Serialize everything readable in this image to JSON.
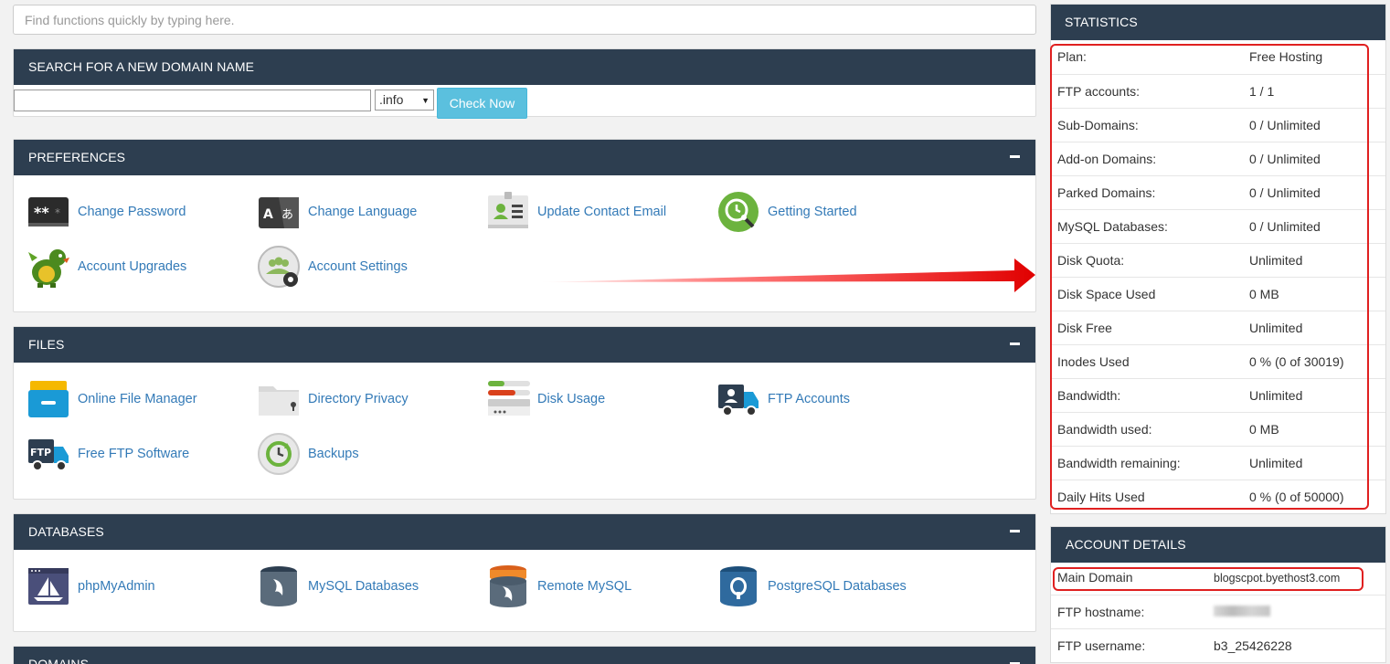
{
  "quick_search": {
    "placeholder": "Find functions quickly by typing here."
  },
  "domain_search": {
    "title": "SEARCH FOR A NEW DOMAIN NAME",
    "input_value": "",
    "tld_selected": ".info",
    "check_label": "Check Now"
  },
  "preferences": {
    "title": "PREFERENCES",
    "items": [
      {
        "label": "Change Password",
        "icon": "password-icon"
      },
      {
        "label": "Change Language",
        "icon": "language-icon"
      },
      {
        "label": "Update Contact Email",
        "icon": "contact-card-icon"
      },
      {
        "label": "Getting Started",
        "icon": "getting-started-icon"
      },
      {
        "label": "Account Upgrades",
        "icon": "dragon-icon"
      },
      {
        "label": "Account Settings",
        "icon": "account-settings-icon"
      }
    ]
  },
  "files": {
    "title": "FILES",
    "items": [
      {
        "label": "Online File Manager",
        "icon": "file-manager-icon"
      },
      {
        "label": "Directory Privacy",
        "icon": "folder-lock-icon"
      },
      {
        "label": "Disk Usage",
        "icon": "disk-usage-icon"
      },
      {
        "label": "FTP Accounts",
        "icon": "ftp-truck-icon"
      },
      {
        "label": "Free FTP Software",
        "icon": "ftp-software-icon"
      },
      {
        "label": "Backups",
        "icon": "backup-icon"
      }
    ]
  },
  "databases": {
    "title": "DATABASES",
    "items": [
      {
        "label": "phpMyAdmin",
        "icon": "phpmyadmin-icon"
      },
      {
        "label": "MySQL Databases",
        "icon": "mysql-icon"
      },
      {
        "label": "Remote MySQL",
        "icon": "remote-mysql-icon"
      },
      {
        "label": "PostgreSQL Databases",
        "icon": "postgresql-icon"
      }
    ]
  },
  "domains": {
    "title": "DOMAINS"
  },
  "statistics": {
    "title": "STATISTICS",
    "rows": [
      {
        "k": "Plan:",
        "v": "Free Hosting"
      },
      {
        "k": "FTP accounts:",
        "v": "1 / 1"
      },
      {
        "k": "Sub-Domains:",
        "v": "0 / Unlimited"
      },
      {
        "k": "Add-on Domains:",
        "v": "0 / Unlimited"
      },
      {
        "k": "Parked Domains:",
        "v": "0 / Unlimited"
      },
      {
        "k": "MySQL Databases:",
        "v": "0 / Unlimited"
      },
      {
        "k": "Disk Quota:",
        "v": "Unlimited"
      },
      {
        "k": "Disk Space Used",
        "v": "0 MB"
      },
      {
        "k": "Disk Free",
        "v": "Unlimited"
      },
      {
        "k": "Inodes Used",
        "v": "0 % (0 of 30019)"
      },
      {
        "k": "Bandwidth:",
        "v": "Unlimited"
      },
      {
        "k": "Bandwidth used:",
        "v": "0 MB"
      },
      {
        "k": "Bandwidth remaining:",
        "v": "Unlimited"
      },
      {
        "k": "Daily Hits Used",
        "v": "0 % (0 of 50000)"
      }
    ]
  },
  "account_details": {
    "title": "ACCOUNT DETAILS",
    "main_domain_label": "Main Domain",
    "main_domain_value": "blogscpot.byethost3.com",
    "ftp_hostname_label": "FTP hostname:",
    "ftp_username_label": "FTP username:",
    "ftp_username_value": "b3_25426228"
  },
  "colors": {
    "header_bg": "#2d3e50",
    "link": "#337ab7",
    "check_button": "#5bc0de",
    "annotation_red": "#e02020"
  }
}
